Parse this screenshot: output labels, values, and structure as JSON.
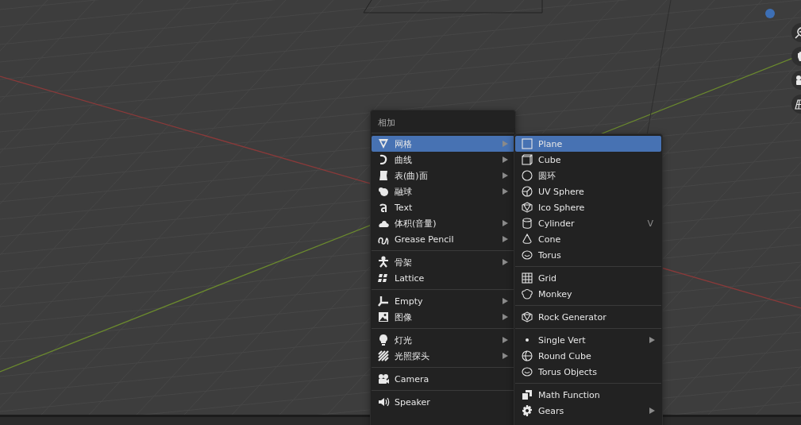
{
  "add_menu": {
    "title": "相加",
    "groups": [
      [
        {
          "label": "网格",
          "submenu": true,
          "selected": true
        },
        {
          "label": "曲线",
          "submenu": true,
          "selected": false
        },
        {
          "label": "表(曲)面",
          "submenu": true,
          "selected": false
        },
        {
          "label": "融球",
          "submenu": true,
          "selected": false
        },
        {
          "label": "Text",
          "submenu": false,
          "selected": false
        },
        {
          "label": "体积(音量)",
          "submenu": true,
          "selected": false
        },
        {
          "label": "Grease Pencil",
          "submenu": true,
          "selected": false
        }
      ],
      [
        {
          "label": "骨架",
          "submenu": true,
          "selected": false
        },
        {
          "label": "Lattice",
          "submenu": false,
          "selected": false
        }
      ],
      [
        {
          "label": "Empty",
          "submenu": true,
          "selected": false
        },
        {
          "label": "图像",
          "submenu": true,
          "selected": false
        }
      ],
      [
        {
          "label": "灯光",
          "submenu": true,
          "selected": false
        },
        {
          "label": "光照探头",
          "submenu": true,
          "selected": false
        }
      ],
      [
        {
          "label": "Camera",
          "submenu": false,
          "selected": false
        }
      ],
      [
        {
          "label": "Speaker",
          "submenu": false,
          "selected": false
        }
      ]
    ]
  },
  "mesh_submenu": {
    "groups": [
      [
        {
          "label": "Plane",
          "selected": true
        },
        {
          "label": "Cube",
          "selected": false
        },
        {
          "label": "圆环",
          "selected": false
        },
        {
          "label": "UV Sphere",
          "selected": false
        },
        {
          "label": "Ico Sphere",
          "selected": false
        },
        {
          "label": "Cylinder",
          "shortcut": "V",
          "selected": false
        },
        {
          "label": "Cone",
          "selected": false
        },
        {
          "label": "Torus",
          "selected": false
        }
      ],
      [
        {
          "label": "Grid",
          "selected": false
        },
        {
          "label": "Monkey",
          "selected": false
        }
      ],
      [
        {
          "label": "Rock Generator",
          "selected": false
        }
      ],
      [
        {
          "label": "Single Vert",
          "submenu": true,
          "selected": false
        },
        {
          "label": "Round Cube",
          "selected": false
        },
        {
          "label": "Torus Objects",
          "selected": false
        }
      ],
      [
        {
          "label": "Math Function",
          "selected": false
        },
        {
          "label": "Gears",
          "submenu": true,
          "selected": false
        }
      ]
    ]
  }
}
